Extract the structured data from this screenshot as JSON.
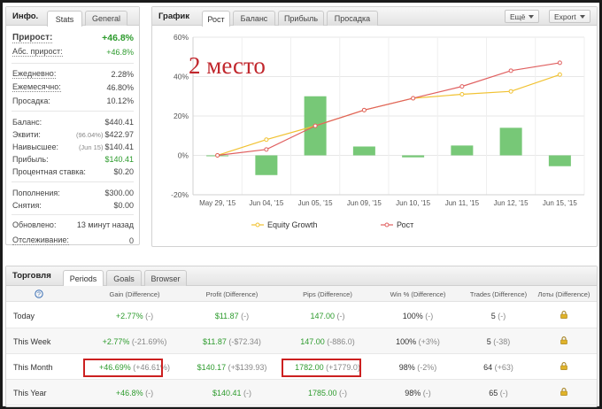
{
  "info": {
    "title": "Инфо.",
    "tabs": [
      "Stats",
      "General"
    ],
    "rows": {
      "growth": {
        "label": "Прирост:",
        "value": "+46.8%"
      },
      "abs_growth": {
        "label": "Абс. прирост:",
        "value": "+46.8%"
      },
      "daily": {
        "label": "Ежедневно:",
        "value": "2.28%"
      },
      "monthly": {
        "label": "Ежемесячно:",
        "value": "46.80%"
      },
      "drawdown": {
        "label": "Просадка:",
        "value": "10.12%"
      },
      "balance": {
        "label": "Баланс:",
        "value": "$440.41"
      },
      "equity": {
        "label": "Эквити:",
        "sub": "(96.04%)",
        "value": "$422.97"
      },
      "highest": {
        "label": "Наивысшее:",
        "sub": "(Jun 15)",
        "value": "$140.41"
      },
      "profit": {
        "label": "Прибыль:",
        "value": "$140.41"
      },
      "interest": {
        "label": "Процентная ставка:",
        "value": "$0.20"
      },
      "deposits": {
        "label": "Пополнения:",
        "value": "$300.00"
      },
      "withdrawals": {
        "label": "Снятия:",
        "value": "$0.00"
      },
      "updated": {
        "label": "Обновлено:",
        "value": "13 минут назад"
      },
      "tracking": {
        "label": "Отслеживание:",
        "value": "0"
      }
    }
  },
  "chart_panel": {
    "title": "График",
    "tabs": [
      "Рост",
      "Баланс",
      "Прибыль",
      "Просадка"
    ],
    "more_label": "Ещё",
    "export_label": "Export",
    "overlay_text": "2 место"
  },
  "chart_data": {
    "type": "bar",
    "categories": [
      "May 29, '15",
      "Jun 04, '15",
      "Jun 05, '15",
      "Jun 09, '15",
      "Jun 10, '15",
      "Jun 11, '15",
      "Jun 12, '15",
      "Jun 15, '15"
    ],
    "ylim": [
      -20,
      60
    ],
    "yticks": [
      "60%",
      "40%",
      "20%",
      "0%",
      "-20%"
    ],
    "ytick_values": [
      60,
      40,
      20,
      0,
      -20
    ],
    "grid": true,
    "legend_position": "bottom",
    "series": [
      {
        "name": "",
        "kind": "bar",
        "color": "#77c877",
        "values": [
          0,
          -10,
          30,
          4.5,
          -1,
          5,
          14,
          -5.5
        ]
      },
      {
        "name": "Equity Growth",
        "kind": "line",
        "color": "#f1c232",
        "values": [
          0,
          8,
          15,
          23,
          29,
          31,
          32.5,
          41
        ]
      },
      {
        "name": "Рост",
        "kind": "line",
        "color": "#e06060",
        "values": [
          0,
          3,
          15,
          23,
          29,
          35,
          43,
          47
        ]
      }
    ]
  },
  "trading": {
    "title": "Торговля",
    "tabs": [
      "Periods",
      "Goals",
      "Browser"
    ],
    "headers": [
      "Gain (Difference)",
      "Profit (Difference)",
      "Pips (Difference)",
      "Win % (Difference)",
      "Trades (Difference)",
      "Лоты (Difference)"
    ],
    "rows": [
      {
        "name": "Today",
        "gain": "+2.77%",
        "gain_diff": "(-)",
        "profit": "$11.87",
        "profit_diff": "(-)",
        "pips": "147.00",
        "pips_diff": "(-)",
        "win": "100%",
        "win_diff": "(-)",
        "trades": "5",
        "trades_diff": "(-)"
      },
      {
        "name": "This Week",
        "gain": "+2.77%",
        "gain_diff": "(-21.69%)",
        "profit": "$11.87",
        "profit_diff": "(-$72.34)",
        "pips": "147.00",
        "pips_diff": "(-886.0)",
        "win": "100%",
        "win_diff": "(+3%)",
        "trades": "5",
        "trades_diff": "(-38)"
      },
      {
        "name": "This Month",
        "gain": "+46.69%",
        "gain_diff": "(+46.61%)",
        "profit": "$140.17",
        "profit_diff": "(+$139.93)",
        "pips": "1782.00",
        "pips_diff": "(+1779.0)",
        "win": "98%",
        "win_diff": "(-2%)",
        "trades": "64",
        "trades_diff": "(+63)"
      },
      {
        "name": "This Year",
        "gain": "+46.8%",
        "gain_diff": "(-)",
        "profit": "$140.41",
        "profit_diff": "(-)",
        "pips": "1785.00",
        "pips_diff": "(-)",
        "win": "98%",
        "win_diff": "(-)",
        "trades": "65",
        "trades_diff": "(-)"
      }
    ]
  }
}
